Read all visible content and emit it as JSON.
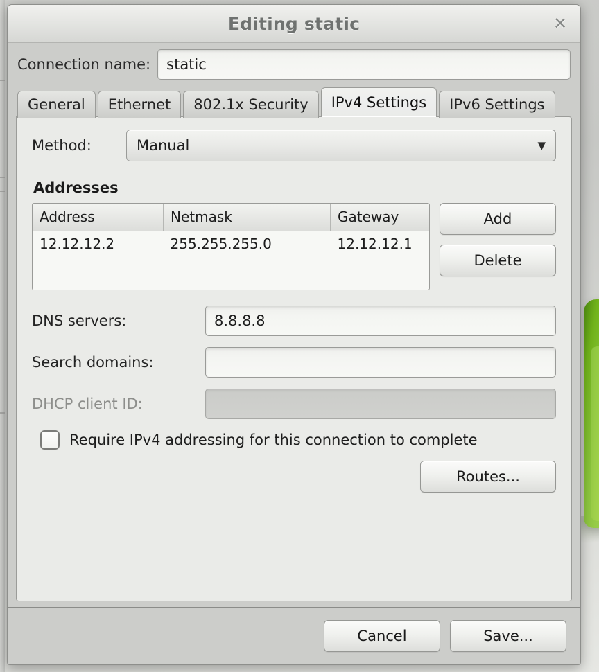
{
  "window": {
    "title": "Editing static",
    "close_icon": "close-icon"
  },
  "connection": {
    "label": "Connection name:",
    "value": "static",
    "placeholder": ""
  },
  "tabs": [
    {
      "label": "General",
      "active": false
    },
    {
      "label": "Ethernet",
      "active": false
    },
    {
      "label": "802.1x Security",
      "active": false
    },
    {
      "label": "IPv4 Settings",
      "active": true
    },
    {
      "label": "IPv6 Settings",
      "active": false
    }
  ],
  "ipv4": {
    "method": {
      "label": "Method:",
      "value": "Manual",
      "arrow_icon": "chevron-down-icon"
    },
    "addresses": {
      "title": "Addresses",
      "columns": [
        "Address",
        "Netmask",
        "Gateway"
      ],
      "rows": [
        [
          "12.12.12.2",
          "255.255.255.0",
          "12.12.12.1"
        ]
      ],
      "add_label": "Add",
      "delete_label": "Delete"
    },
    "dns": {
      "label": "DNS servers:",
      "value": "8.8.8.8",
      "placeholder": ""
    },
    "search_domains": {
      "label": "Search domains:",
      "value": "",
      "placeholder": ""
    },
    "dhcp_client_id": {
      "label": "DHCP client ID:",
      "value": "",
      "placeholder": "",
      "disabled": true
    },
    "require_ipv4": {
      "label": "Require IPv4 addressing for this connection to complete",
      "checked": false
    },
    "routes_label": "Routes..."
  },
  "actions": {
    "cancel_label": "Cancel",
    "save_label": "Save..."
  },
  "colors": {
    "dialog_bg": "#cccdca",
    "panel_bg": "#eaebe8",
    "entry_bg": "#f7f8f5",
    "title_text": "#6f7270",
    "desktop_accent": "#8dc63f",
    "disabled_text": "#8d8e8b"
  }
}
